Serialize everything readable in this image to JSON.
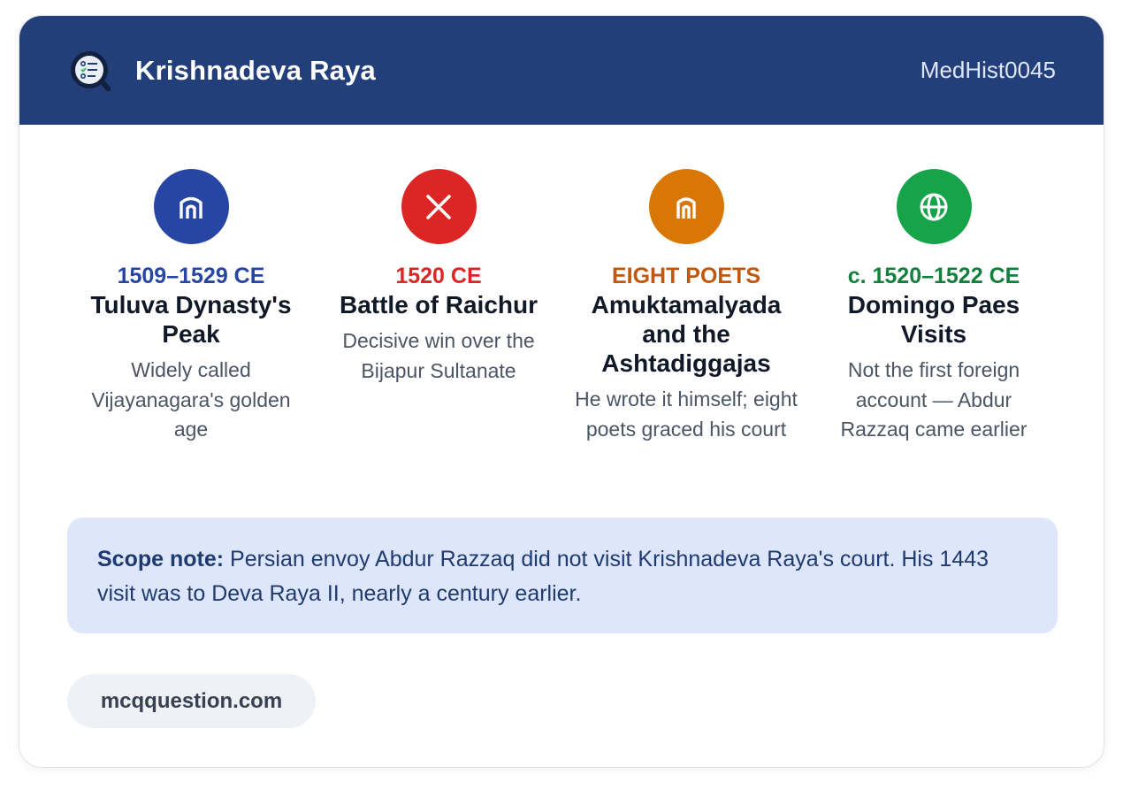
{
  "header": {
    "title": "Krishnadeva Raya",
    "code": "MedHist0045",
    "logo_icon": "quiz-checklist-icon"
  },
  "facts": [
    {
      "icon": "temple-icon",
      "color": "#2746a4",
      "kicker": "1509–1529 CE",
      "heading": "Tuluva Dynasty's Peak",
      "desc": "Widely called Vijayanagara's golden age"
    },
    {
      "icon": "close-x-icon",
      "color": "#dc2626",
      "kicker": "1520 CE",
      "heading": "Battle of Raichur",
      "desc": "Decisive win over the Bijapur Sultanate"
    },
    {
      "icon": "temple-icon",
      "color": "#d97706",
      "kicker_color": "#c2570e",
      "kicker": "EIGHT POETS",
      "heading": "Amuktamalyada and the Ashtadiggajas",
      "desc": "He wrote it himself; eight poets graced his court"
    },
    {
      "icon": "globe-icon",
      "color": "#16a34a",
      "kicker_color": "#15803d",
      "kicker": "c. 1520–1522 CE",
      "heading": "Domingo Paes Visits",
      "desc": "Not the first foreign account — Abdur Razzaq came earlier"
    }
  ],
  "note": {
    "label": "Scope note:",
    "text": " Persian envoy Abdur Razzaq did not visit Krishnadeva Raya's court. His 1443 visit was to Deva Raya II, nearly a century earlier."
  },
  "footer": {
    "site": "mcqquestion.com"
  }
}
